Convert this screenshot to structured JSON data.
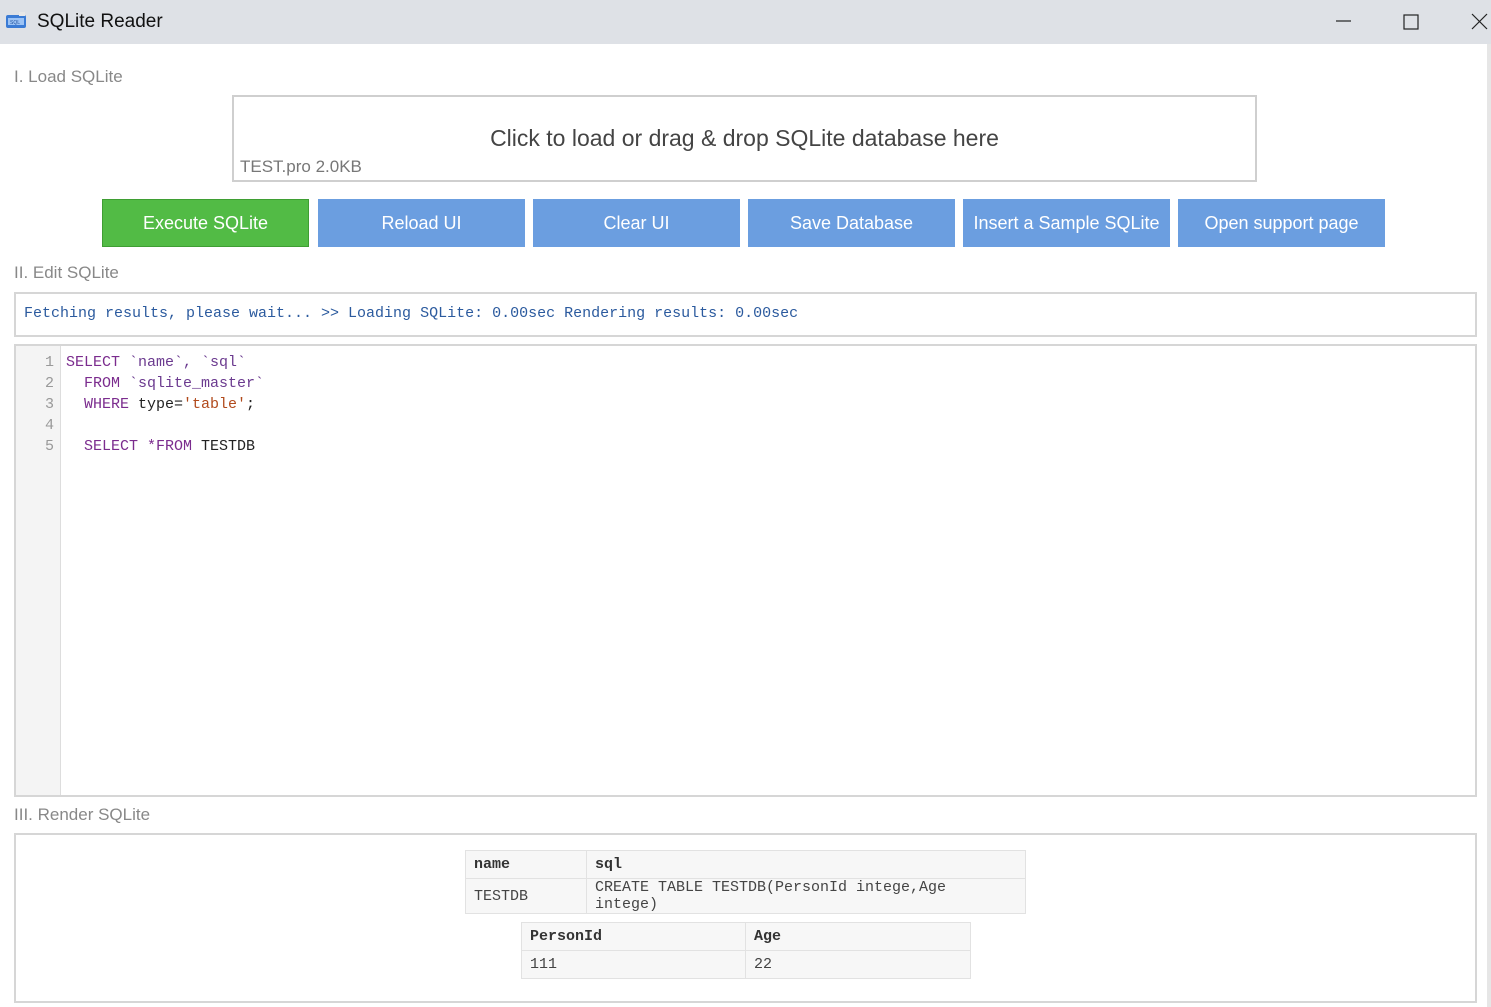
{
  "window": {
    "title": "SQLite Reader",
    "icon": "app-database-icon"
  },
  "sections": {
    "load": "I. Load SQLite",
    "edit": "II. Edit SQLite",
    "render": "III. Render SQLite"
  },
  "dropzone": {
    "text": "Click to load or drag & drop SQLite database here",
    "file_info": "TEST.pro 2.0KB"
  },
  "buttons": {
    "execute": "Execute SQLite",
    "reload": "Reload UI",
    "clear": "Clear UI",
    "save": "Save Database",
    "insert_sample": "Insert a Sample SQLite",
    "support": "Open support page"
  },
  "status": "Fetching results, please wait... >> Loading SQLite: 0.00sec Rendering results: 0.00sec",
  "editor": {
    "line_numbers": [
      "1",
      "2",
      "3",
      "4",
      "5"
    ],
    "lines": [
      [
        "SELECT",
        " `name`, `sql`"
      ],
      [
        "  FROM",
        " `sqlite_master`"
      ],
      [
        "  WHERE",
        " type=",
        "'table'",
        ";"
      ],
      [
        ""
      ],
      [
        "  SELECT *FROM",
        " TESTDB"
      ]
    ]
  },
  "results": {
    "table1": {
      "headers": [
        "name",
        "sql"
      ],
      "rows": [
        [
          "TESTDB",
          "CREATE TABLE TESTDB(PersonId intege,Age intege)"
        ]
      ]
    },
    "table2": {
      "headers": [
        "PersonId",
        "Age"
      ],
      "rows": [
        [
          "111",
          "22"
        ]
      ]
    }
  },
  "colors": {
    "execute": "#52bb45",
    "button": "#6b9ee0",
    "status_text": "#2b5a9e"
  }
}
